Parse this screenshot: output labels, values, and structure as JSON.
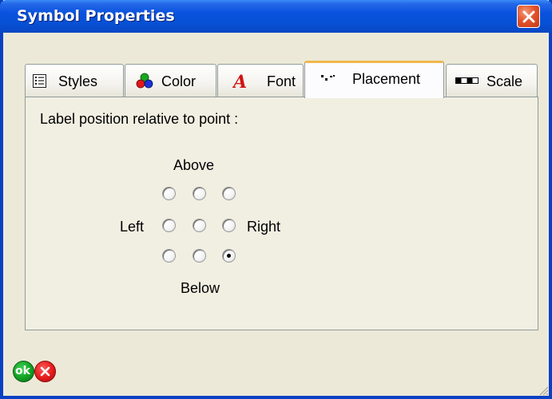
{
  "window": {
    "title": "Symbol Properties"
  },
  "tabs": [
    {
      "label": "Styles",
      "icon": "list-icon"
    },
    {
      "label": "Color",
      "icon": "color-circles-icon"
    },
    {
      "label": "Font",
      "icon": "font-a-icon"
    },
    {
      "label": "Placement",
      "icon": "placement-dots-icon",
      "active": true
    },
    {
      "label": "Scale",
      "icon": "scale-bar-icon"
    }
  ],
  "placement": {
    "instruction": "Label position relative to point :",
    "above_label": "Above",
    "below_label": "Below",
    "left_label": "Left",
    "right_label": "Right",
    "selected_position": "bottom-right"
  },
  "footer": {
    "ok_label": "ok",
    "ok_icon": "ok-icon",
    "cancel_icon": "cancel-icon"
  },
  "colors": {
    "titlebar": "#0a52de",
    "frame": "#0841c4",
    "dialog_bg": "#ece9d8",
    "panel_bg": "#f1efe2",
    "active_tab_accent": "#f1b84c",
    "close_button": "#e3542c",
    "ok_green": "#13a024",
    "cancel_red": "#e31b1b"
  }
}
